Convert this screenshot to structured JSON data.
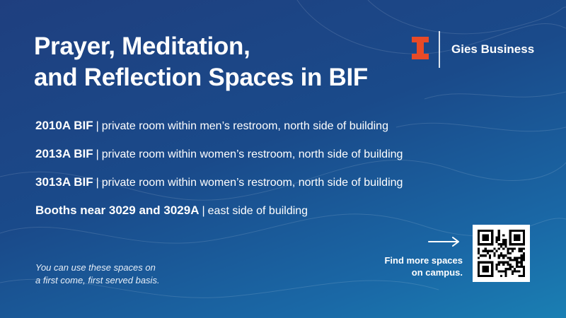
{
  "title": {
    "line1": "Prayer, Meditation,",
    "line2": "and Reflection Spaces in BIF"
  },
  "logo": {
    "text": "Gies Business",
    "icon": "block-i-icon",
    "accent_color": "#e84a27"
  },
  "rooms": [
    {
      "name": "2010A BIF",
      "separator": "|",
      "description": "private room within men’s restroom, north side of building"
    },
    {
      "name": "2013A BIF",
      "separator": "|",
      "description": "private room within women’s restroom, north side of building"
    },
    {
      "name": "3013A BIF",
      "separator": "|",
      "description": "private room within women’s restroom, north side of building"
    },
    {
      "name": "Booths near 3029 and 3029A",
      "separator": "|",
      "description": "east side of building"
    }
  ],
  "note": {
    "line1": "You can use these spaces on",
    "line2": "a first come, first served basis."
  },
  "cta": {
    "line1": "Find more spaces",
    "line2": "on campus.",
    "arrow_icon": "right-arrow-icon",
    "qr_icon": "qr-code-icon"
  },
  "colors": {
    "background_start": "#1f3f7f",
    "background_end": "#1a7fb3",
    "text": "#ffffff"
  }
}
